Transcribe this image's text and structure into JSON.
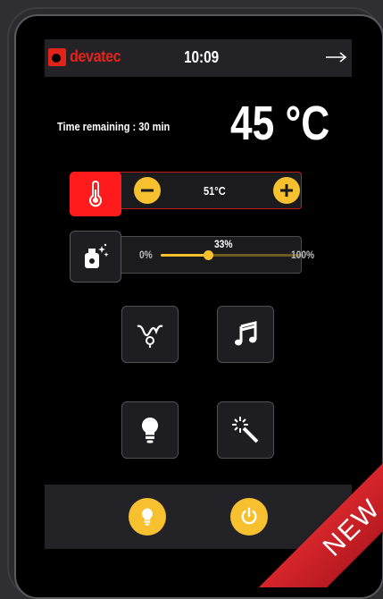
{
  "brand": {
    "name": "devatec",
    "color": "#e2231a"
  },
  "header": {
    "time": "10:09",
    "exit_icon": "arrow-right-icon"
  },
  "status": {
    "time_remaining": "Time remaining : 30 min",
    "current_temp": "45 °C"
  },
  "temperature_control": {
    "setpoint": "51°C",
    "icon": "thermometer-icon",
    "minus_icon": "minus-icon",
    "plus_icon": "plus-icon"
  },
  "aroma_control": {
    "min_label": "0%",
    "max_label": "100%",
    "value_label": "33%",
    "value": 0.33,
    "icon": "fragrance-bottle-icon"
  },
  "functions": [
    {
      "icon": "massage-icon"
    },
    {
      "icon": "music-note-icon"
    },
    {
      "icon": "light-bulb-icon"
    },
    {
      "icon": "magic-wand-icon"
    }
  ],
  "bottom_bar": {
    "light_icon": "light-bulb-icon",
    "power_icon": "power-icon"
  },
  "ribbon": {
    "text": "NEW"
  },
  "colors": {
    "accent_yellow": "#f6c02f",
    "alert_red": "#ff1b1b",
    "panel": "#222227"
  }
}
